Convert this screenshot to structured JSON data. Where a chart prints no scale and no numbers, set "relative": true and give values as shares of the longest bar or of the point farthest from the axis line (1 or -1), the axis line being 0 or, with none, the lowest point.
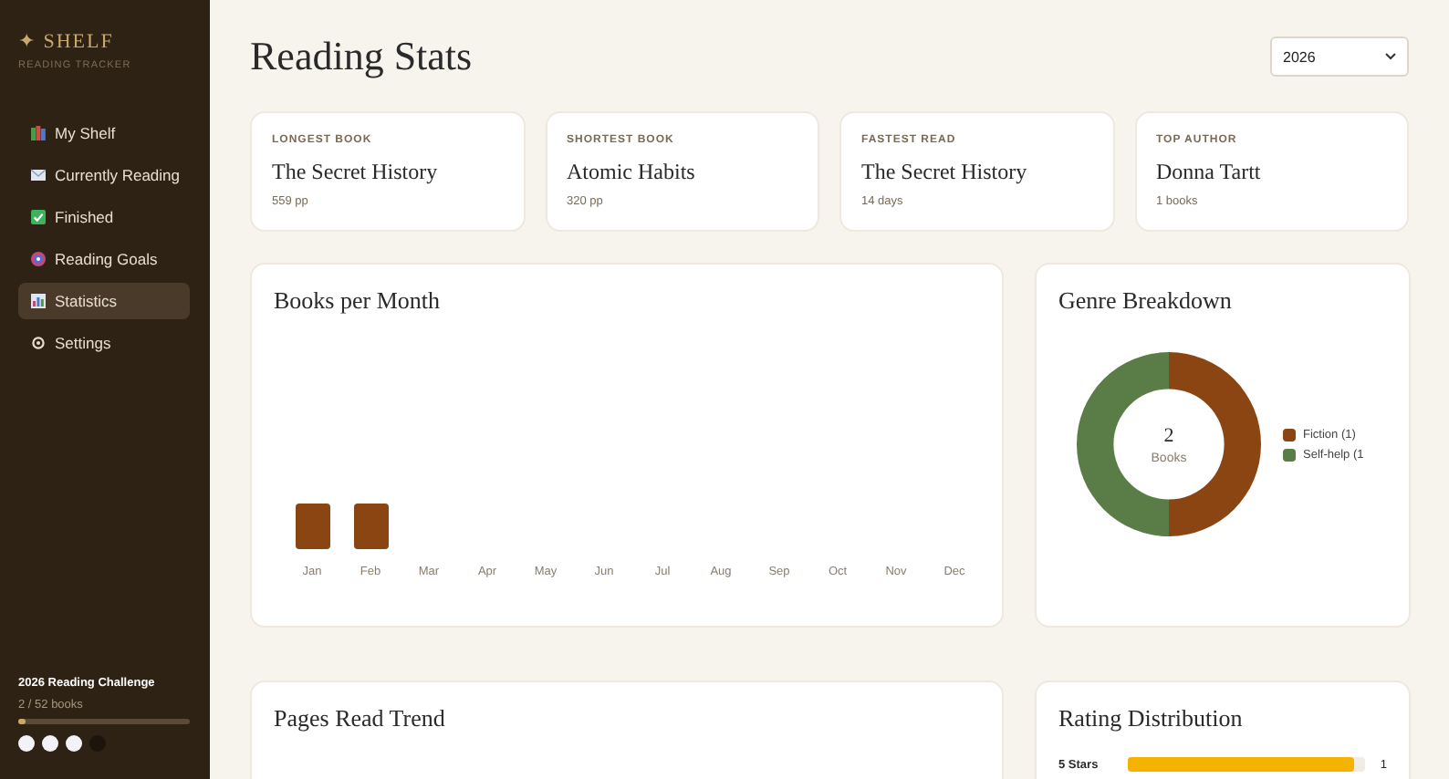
{
  "sidebar": {
    "logo": "✦ SHELF",
    "subtitle": "READING TRACKER",
    "items": [
      {
        "label": "My Shelf",
        "kind": "books",
        "selected": false
      },
      {
        "label": "Currently Reading",
        "kind": "envelope",
        "selected": false
      },
      {
        "label": "Finished",
        "kind": "check",
        "selected": false
      },
      {
        "label": "Reading Goals",
        "kind": "target",
        "selected": false
      },
      {
        "label": "Statistics",
        "kind": "chart",
        "selected": true
      },
      {
        "label": "Settings",
        "kind": "gear",
        "selected": false
      }
    ],
    "challenge": {
      "title": "2026 Reading Challenge",
      "progress": "2 / 52 books",
      "level": 0.04,
      "dots": [
        {
          "filled": true
        },
        {
          "filled": true
        },
        {
          "filled": true
        },
        {
          "filled": false
        }
      ]
    }
  },
  "header": {
    "title": "Reading Stats",
    "year": "2026"
  },
  "stats": [
    {
      "label": "LONGEST BOOK",
      "value": "The Secret History",
      "detail": "559 pp"
    },
    {
      "label": "SHORTEST BOOK",
      "value": "Atomic Habits",
      "detail": "320 pp"
    },
    {
      "label": "FASTEST READ",
      "value": "The Secret History",
      "detail": "14 days"
    },
    {
      "label": "TOP AUTHOR",
      "value": "Donna Tartt",
      "detail": "1 books"
    }
  ],
  "books_per_month": {
    "title": "Books per Month",
    "chart_data": {
      "type": "bar",
      "categories": [
        "Jan",
        "Feb",
        "Mar",
        "Apr",
        "May",
        "Jun",
        "Jul",
        "Aug",
        "Sep",
        "Oct",
        "Nov",
        "Dec"
      ],
      "relative": true,
      "color": "#8b4513",
      "values": [
        1,
        1,
        0,
        0,
        0,
        0,
        0,
        0,
        0,
        0,
        0,
        0
      ]
    }
  },
  "genre_breakdown": {
    "title": "Genre Breakdown",
    "total": "2",
    "total_label": "Books",
    "chart_data": {
      "type": "donut",
      "values": [
        50,
        50
      ]
    },
    "legend": [
      {
        "label": "Fiction (1)",
        "color": "#8b4513"
      },
      {
        "label": "Self-help (1",
        "color": "#5a7d47"
      }
    ]
  },
  "pages_trend": {
    "title": "Pages Read Trend"
  },
  "rating_distribution": {
    "title": "Rating Distribution",
    "rows": [
      {
        "label": "5 Stars",
        "level": 0.95,
        "count": "1"
      }
    ]
  }
}
